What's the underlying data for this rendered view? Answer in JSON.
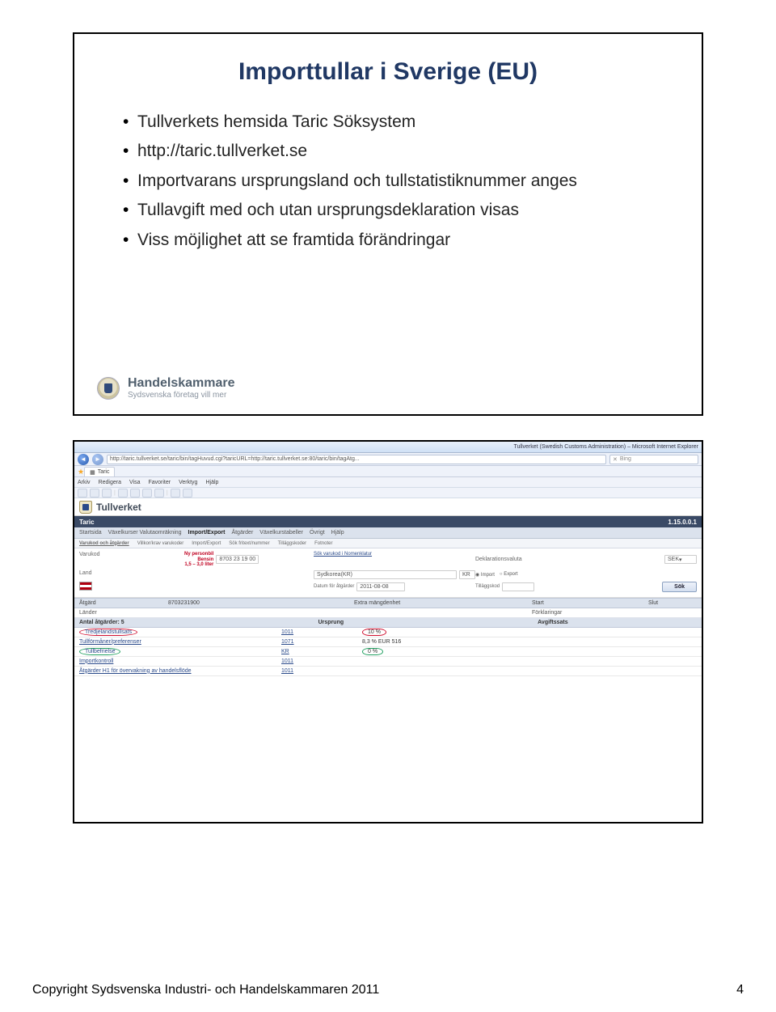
{
  "slide1": {
    "title": "Importtullar i Sverige (EU)",
    "bullets": [
      "Tullverkets hemsida Taric Söksystem",
      "http://taric.tullverket.se",
      "Importvarans ursprungsland och tullstatistiknummer anges",
      "Tullavgift med och utan ursprungsdeklaration visas",
      "Viss möjlighet att se framtida förändringar"
    ],
    "logo": {
      "name": "Handelskammare",
      "tagline": "Sydsvenska företag vill mer"
    }
  },
  "slide2": {
    "browser": {
      "titlebar": "Tullverket (Swedish Customs Administration) – Microsoft Internet Explorer",
      "url": "http://taric.tullverket.se/taric/bin/tagHuvud.cgi?taricURL=http://taric.tullverket.se:80/taric/bin/tagAtg...",
      "search": "Bing",
      "tab": "Taric",
      "menus": [
        "Arkiv",
        "Redigera",
        "Visa",
        "Favoriter",
        "Verktyg",
        "Hjälp"
      ]
    },
    "site": {
      "brand": "Tullverket",
      "topbar_left": "Taric",
      "topbar_right": "1.15.0.0.1",
      "tabs": [
        "Startsida",
        "Växelkurser Valutaomräkning",
        "Import/Export",
        "Åtgärder",
        "Växelkurstabeller",
        "Övrigt",
        "Hjälp"
      ],
      "subtabs": [
        "Varukod och åtgärder",
        "Villkor/krav varukoder",
        "Import/Export",
        "Sök fritext/nummer",
        "Tilläggskoder",
        "Fotnoter"
      ]
    },
    "form": {
      "varukod_label": "Varukod",
      "varukod_value": "8703 23 19 00",
      "varukod_note": {
        "l1": "Ny personbil",
        "l2": "Bensin",
        "l3": "1,5 – 3,0 liter"
      },
      "land_label": "Land",
      "land_value": "Sydkorea(KR)",
      "land_code": "KR",
      "deklarationsvaluta": "SEK",
      "deklarationsvaluta_label": "Deklarationsvaluta",
      "datum_label": "Datum för åtgärder",
      "datum_value": "2011-08-08",
      "import_radio": "Import",
      "export_radio": "Export",
      "tilläggskod_label": "Tilläggskod",
      "button": "Sök"
    },
    "grid": {
      "headers": [
        "Åtgärd",
        "",
        "Extra mängdenhet",
        "Start",
        "Slut"
      ],
      "sublabels": [
        "Länder",
        "",
        "",
        "Förklaringar",
        ""
      ],
      "val_line1": "8703231900",
      "antal_label": "Antal åtgärder: 5",
      "ursprung_label": "Ursprung",
      "avgift_label": "Avgiftssats",
      "rows": [
        {
          "name": "Tredjelandstullsats",
          "code": "1011",
          "val": "10 %",
          "mark": "red"
        },
        {
          "name": "Tullförmåner/preferenser",
          "code": "1071",
          "val": "8,3 % EUR 516",
          "mark": "green"
        },
        {
          "name": "Tullbefrielse",
          "code": "KR",
          "val": "0 %",
          "mark": "green"
        },
        {
          "name": "Importkontroll",
          "code": "1011",
          "val": "",
          "mark": ""
        },
        {
          "name": "Åtgärder H1 för övervakning av handelsflöde",
          "code": "1011",
          "val": "",
          "mark": ""
        }
      ]
    }
  },
  "footer": {
    "copyright": "Copyright Sydsvenska Industri- och Handelskammaren 2011",
    "page": "4"
  }
}
